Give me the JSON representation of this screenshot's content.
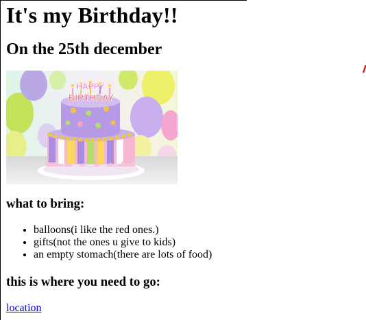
{
  "page": {
    "title": "It's my Birthday!!",
    "subtitle": "On the 25th december",
    "image_text_line1": "HAPPY",
    "image_text_line2": "BIRTHDAY",
    "bring_heading": "what to bring:",
    "bring_items": [
      "balloons(i like the red ones.)",
      "gifts(not the ones u give to kids)",
      "an empty stomach(there are lots of food)"
    ],
    "go_heading": "this is where you need to go:",
    "location_link": "location"
  },
  "colors": {
    "link": "#0000ee",
    "mark": "#e02020"
  }
}
